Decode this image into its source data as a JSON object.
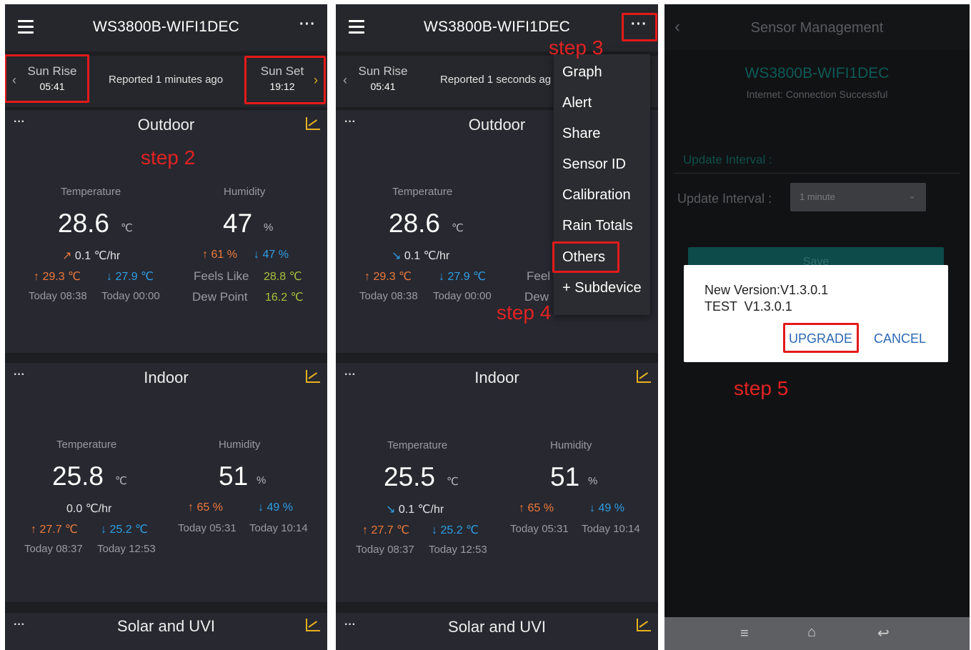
{
  "device_name": "WS3800B-WIFI1DEC",
  "more_glyph": "···",
  "dots_glyph": "···",
  "sunrise": {
    "label": "Sun Rise",
    "time": "05:41"
  },
  "sunset": {
    "label": "Sun Set",
    "time": "19:12"
  },
  "panel1": {
    "reported": "Reported 1 minutes ago",
    "outdoor": {
      "title": "Outdoor",
      "temp_label": "Temperature",
      "temp": "28.6",
      "temp_unit": "℃",
      "temp_rate": "0.1",
      "rate_unit": "℃/hr",
      "temp_high": "29.3 ℃",
      "temp_low": "27.9 ℃",
      "temp_high_time": "Today 08:38",
      "temp_low_time": "Today 00:00",
      "hum_label": "Humidity",
      "hum": "47",
      "hum_unit": "%",
      "hum_high": "61 %",
      "hum_low": "47 %",
      "feels_label": "Feels Like",
      "feels": "28.8 ℃",
      "dew_label": "Dew Point",
      "dew": "16.2 ℃"
    },
    "indoor": {
      "title": "Indoor",
      "temp_label": "Temperature",
      "temp": "25.8",
      "temp_unit": "℃",
      "temp_rate": "0.0",
      "rate_unit": "℃/hr",
      "temp_high": "27.7 ℃",
      "temp_low": "25.2 ℃",
      "temp_high_time": "Today 08:37",
      "temp_low_time": "Today 12:53",
      "hum_label": "Humidity",
      "hum": "51",
      "hum_unit": "%",
      "hum_high": "65 %",
      "hum_low": "49 %",
      "hum_high_time": "Today 05:31",
      "hum_low_time": "Today 10:14"
    },
    "solar_title": "Solar and UVI"
  },
  "panel2": {
    "reported": "Reported 1 seconds ag",
    "outdoor": {
      "title": "Outdoor",
      "temp_label": "Temperature",
      "temp": "28.6",
      "temp_unit": "℃",
      "temp_rate": "0.1",
      "rate_unit": "℃/hr",
      "temp_high": "29.3 ℃",
      "temp_low": "27.9 ℃",
      "temp_high_time": "Today 08:38",
      "temp_low_time": "Today 00:00",
      "feels_partial": "Feel",
      "dew_partial": "Dew"
    },
    "indoor": {
      "title": "Indoor",
      "temp_label": "Temperature",
      "temp": "25.5",
      "temp_unit": "℃",
      "temp_rate": "0.1",
      "rate_unit": "℃/hr",
      "temp_high": "27.7 ℃",
      "temp_low": "25.2 ℃",
      "temp_high_time": "Today 08:37",
      "temp_low_time": "Today 12:53",
      "hum_label": "Humidity",
      "hum": "51",
      "hum_unit": "%",
      "hum_high": "65 %",
      "hum_low": "49 %",
      "hum_high_time": "Today 05:31",
      "hum_low_time": "Today 10:14"
    },
    "solar_title": "Solar and UVI",
    "menu": [
      "Graph",
      "Alert",
      "Share",
      "Sensor ID",
      "Calibration",
      "Rain Totals",
      "Others",
      "+ Subdevice"
    ]
  },
  "panel3": {
    "title": "Sensor Management",
    "device": "WS3800B-WIFI1DEC",
    "internet": "Internet: Connection Successful",
    "interval_header": "Update Interval :",
    "interval_label": "Update Interval :",
    "interval_value": "1 minute",
    "save_label": "Save",
    "dialog": {
      "line1": "New Version:V1.3.0.1",
      "line2": "TEST  V1.3.0.1",
      "upgrade": "UPGRADE",
      "cancel": "CANCEL"
    }
  },
  "steps": {
    "s2": "step 2",
    "s3": "step 3",
    "s4": "step 4",
    "s5": "step 5"
  },
  "colors": {
    "highlight": "#e31a1a",
    "accent": "#e7b21f",
    "high": "#f07a3a",
    "low": "#2e9fe6",
    "teal": "#0d6e6a"
  }
}
